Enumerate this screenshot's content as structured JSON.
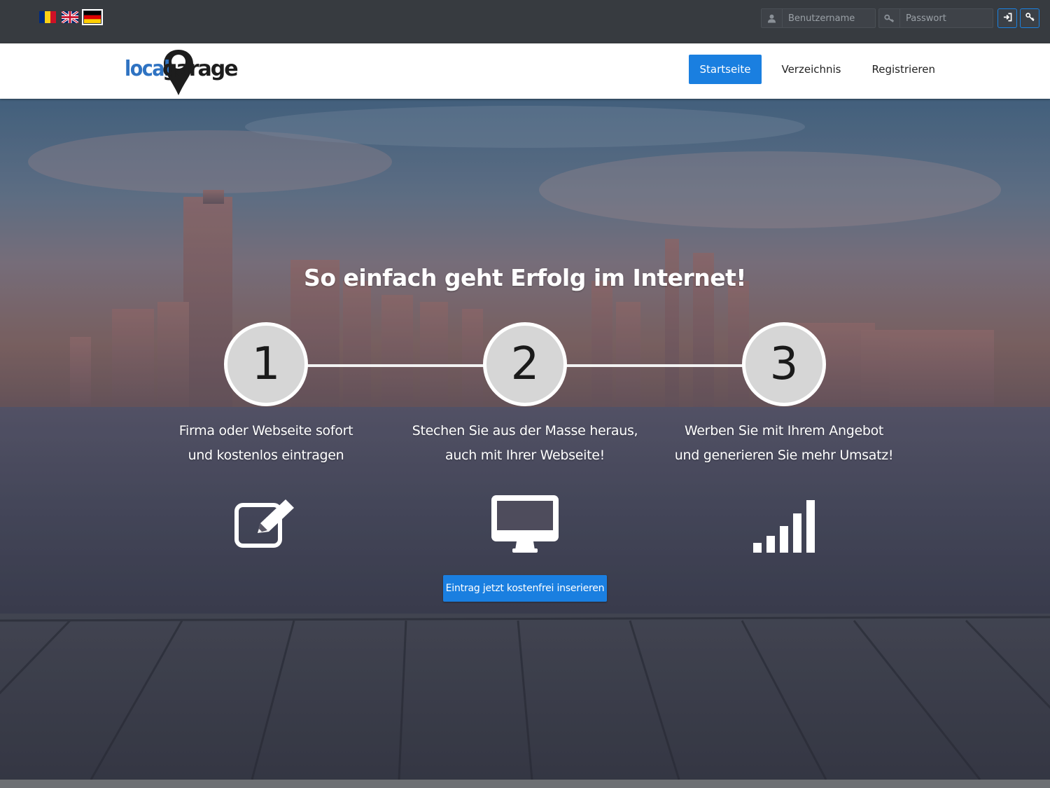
{
  "topbar": {
    "languages": [
      {
        "name": "Romanian",
        "icon": "flag-ro-icon"
      },
      {
        "name": "English",
        "icon": "flag-uk-icon"
      },
      {
        "name": "Deutsch",
        "icon": "flag-de-icon",
        "selected": true
      }
    ],
    "login": {
      "username_placeholder": "Benutzername",
      "password_placeholder": "Passwort",
      "username_icon": "user-icon",
      "password_icon": "key-icon",
      "login_icon": "sign-in-icon",
      "forgot_icon": "key-icon"
    }
  },
  "brand": {
    "logo_part1": "local",
    "logo_part2": "garage",
    "logo_icon": "map-pin-icon"
  },
  "nav": {
    "items": [
      {
        "label": "Startseite",
        "active": true
      },
      {
        "label": "Verzeichnis",
        "active": false
      },
      {
        "label": "Registrieren",
        "active": false
      }
    ]
  },
  "hero": {
    "headline": "So einfach geht Erfolg im Internet!",
    "steps": [
      {
        "number": "1",
        "line1": "Firma oder Webseite sofort",
        "line2": "und kostenlos eintragen",
        "icon": "edit-icon"
      },
      {
        "number": "2",
        "line1": "Stechen Sie aus der Masse heraus,",
        "line2": "auch mit Ihrer Webseite!",
        "icon": "monitor-icon"
      },
      {
        "number": "3",
        "line1": "Werben Sie mit Ihrem Angebot",
        "line2": "und generieren Sie mehr Umsatz!",
        "icon": "signal-bars-icon"
      }
    ],
    "cta_label": "Eintrag jetzt kostenfrei inserieren"
  },
  "colors": {
    "accent": "#1a7fe0",
    "topbar_bg": "#373b40",
    "logo_blue": "#2f73c2"
  }
}
